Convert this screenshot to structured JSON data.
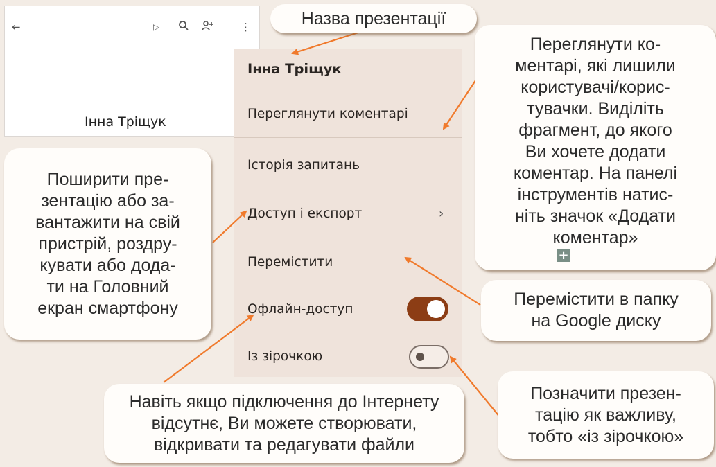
{
  "phone": {
    "icons": [
      "arrow-left-icon",
      "play-icon",
      "search-icon",
      "add-person-icon",
      "more-vert-icon"
    ],
    "doc_title": "Інна Тріщук"
  },
  "menu": {
    "title": "Інна Тріщук",
    "items": [
      {
        "label": "Переглянути коментарі"
      },
      {
        "label": "Історія запитань"
      },
      {
        "label": "Доступ і експорт"
      },
      {
        "label": "Перемістити"
      },
      {
        "label": "Офлайн-доступ",
        "toggle": "on"
      },
      {
        "label": "Із зірочкою",
        "toggle": "off"
      }
    ]
  },
  "callouts": {
    "title_note": [
      "Назва презентації"
    ],
    "comments_note": [
      "Переглянути ко-",
      "ментарі, які лишили",
      "користувачі/корис-",
      "тувачки. Виділіть",
      "фрагмент, до якого",
      "Ви хочете додати",
      "коментар. На панелі",
      "інструментів натис-",
      "ніть значок «Додати"
    ],
    "comments_note_last": "коментар»",
    "share_note": [
      "Поширити пре-",
      "зентацію або за-",
      "вантажити на свій",
      "пристрій, роздру-",
      "кувати або дода-",
      "ти на Головний",
      "екран смартфону"
    ],
    "move_note": [
      "Перемістити в папку",
      "на Google диску"
    ],
    "star_note": [
      "Позначити презен-",
      "тацію як важливу,",
      "тобто «із зірочкою»"
    ],
    "offline_note": [
      "Навіть якщо підключення до Інтернету",
      "відсутнє, Ви можете створювати,",
      "відкривати та редагувати файли"
    ]
  },
  "colors": {
    "arrow": "#f07a2c",
    "toggle_on": "#8c3d15",
    "menu_bg": "#efe3db"
  }
}
